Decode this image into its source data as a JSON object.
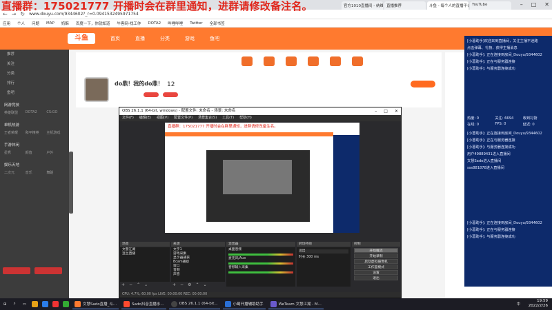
{
  "overlay": {
    "title": "直播群：175021777 开播时会在群里通知，进群请修改备注名。"
  },
  "browser": {
    "url": "www.douyu.com/9344602?_r=0.0941532495971754",
    "tabs": [
      "官方1010直播间 - 纳维斯",
      "直播推荐",
      "斗鱼 - 每个人的直播平台",
      "YouTube"
    ],
    "bookmarks": [
      "应用",
      "个人",
      "问题",
      "MAP",
      "奶酥",
      "百度一下，你就知道",
      "牛客网-找工作",
      "DOTA2",
      "哔哩哔哩",
      "Twitter",
      "全部书签"
    ]
  },
  "douyu": {
    "logo": "斗鱼",
    "nav": [
      "首页",
      "直播",
      "分类",
      "游戏",
      "鱼吧"
    ],
    "room_title": "do鼎！我的do鼎！",
    "viewers": "12",
    "left_menu": [
      "推荐",
      "关注",
      "分类",
      "排行",
      "鱼吧"
    ],
    "left_sections": [
      "网游竞技",
      "单机热游",
      "手游休闲",
      "娱乐天地"
    ],
    "left_games": [
      "英雄联盟",
      "DOTA2",
      "CS:GO",
      "王者荣耀",
      "和平精英",
      "主机游戏",
      "星秀",
      "颜值",
      "户外",
      "二次元",
      "音乐",
      "舞蹈"
    ]
  },
  "chat": {
    "lines_top": [
      "[小葛助手]欢迎来到直播间，关注主播不迷路",
      "点击弹幕、礼物，获得主播消息",
      "[小葛助手]: 正在连接到房间_Douyu/9344602",
      "[小葛助手]: 正在与服务器连接",
      "[小葛助手]: 与服务器连接成功"
    ],
    "stats": [
      "热度: 0",
      "关注: 6694",
      "收到礼物",
      "在线: 0",
      "FPS: 0",
      "延迟: 0"
    ],
    "lines_mid": [
      "[小葛助手]: 正在连接到房间_Douyu/9344602",
      "[小葛助手]: 正在与服务器连接",
      "[小葛助手]: 与服务器连接成功",
      "用户49889431进入直播间",
      "文慧Sado进入直播间",
      "sss881878进入直播间"
    ],
    "lines_bottom": [
      "[小葛助手]: 正在连接到房间_Douyu/9344602",
      "[小葛助手]: 正在与服务器连接",
      "[小葛助手]: 与服务器连接成功"
    ]
  },
  "obs": {
    "title": "OBS 26.1.1 (64-bit, windows) - 配置文件: 未命名 - 场景: 未命名",
    "menu": [
      "文件(F)",
      "编辑(E)",
      "视图(V)",
      "配置文件(P)",
      "场景集合(S)",
      "工具(T)",
      "帮助(H)"
    ],
    "panels": {
      "scenes": "场景",
      "sources": "来源",
      "mixer": "混音器",
      "transitions": "转场特效",
      "controls": "控制"
    },
    "scenes": [
      "文慧江湖",
      "豆丝直播"
    ],
    "sources": [
      "文字1",
      "游戏采集",
      "显示器捕获",
      "Bcam捕捉",
      "窗口",
      "音频",
      "声音"
    ],
    "mixer": [
      "桌面音频",
      "麦克风/Aux",
      "音频输入采集"
    ],
    "transitions": {
      "type": "淡出",
      "duration_label": "时长",
      "duration": "300 ms"
    },
    "controls": [
      "开始推流",
      "开始录制",
      "启动虚拟摄像机",
      "工作室模式",
      "设置",
      "退出"
    ],
    "status": "CPU: 4.7%, 60.00 fps  LIVE: 00:00:00  REC: 00:00:00"
  },
  "taskbar": {
    "apps": [
      "文慧Sado直播_斗...",
      "Sado抖音直播水...",
      "OBS 26.1.1 (64-bit...",
      "小葛开播辅助助手",
      "WeTeam 文慧江湖 - M..."
    ],
    "time": "19:59",
    "date": "2022/2/26",
    "lang": "中"
  }
}
